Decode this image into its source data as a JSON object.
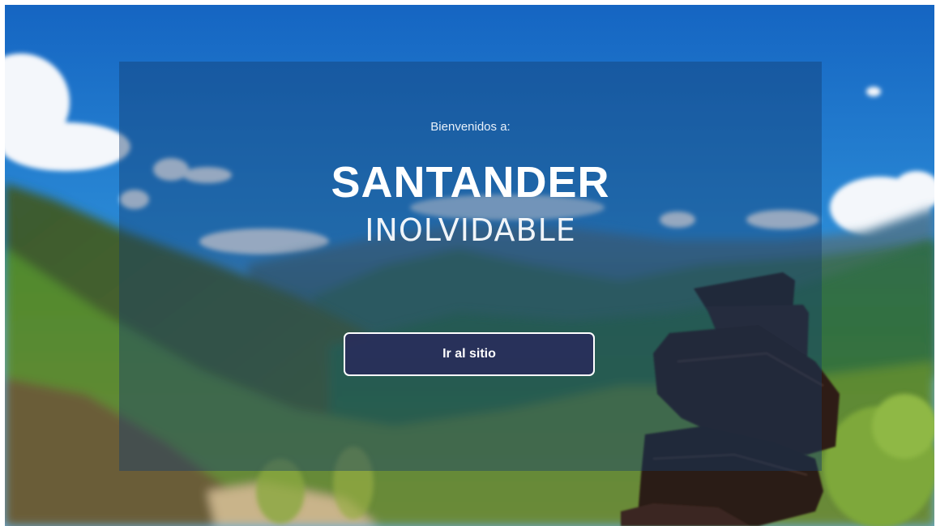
{
  "hero": {
    "welcome_text": "Bienvenidos a:",
    "title": "SANTANDER",
    "subtitle": "INOLVIDABLE",
    "cta_label": "Ir al sitio"
  },
  "colors": {
    "sky": "#1f74c8",
    "overlay": "#143c6e",
    "button_fill": "#2a285c",
    "button_border": "#ffffff",
    "text": "#ffffff"
  }
}
